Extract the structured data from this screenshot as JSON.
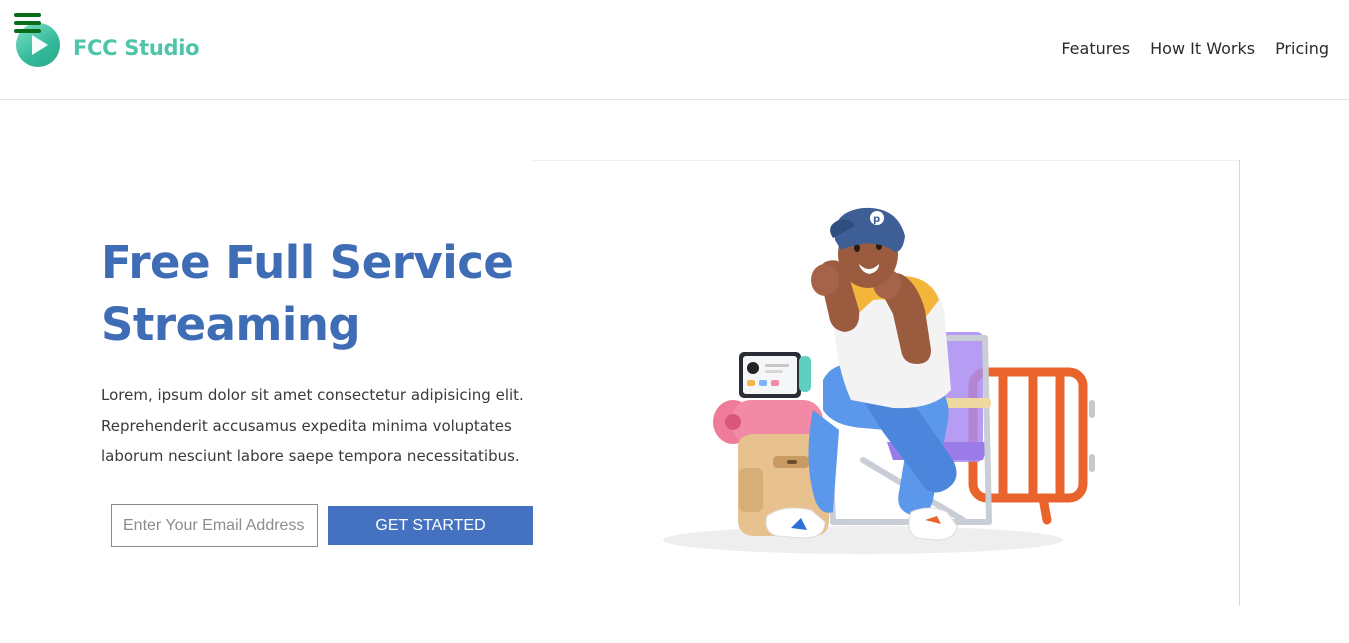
{
  "header": {
    "brand": "FCC Studio",
    "menu_icon": "hamburger-menu-icon",
    "logo_icon": "play-logo-icon",
    "nav": [
      {
        "label": "Features"
      },
      {
        "label": "How It Works"
      },
      {
        "label": "Pricing"
      }
    ]
  },
  "hero": {
    "title": "Free Full Service Streaming",
    "description": "Lorem, ipsum dolor sit amet consectetur adipisicing elit. Reprehenderit accusamus expedita minima voluptates laborum nesciunt labore saepe tempora necessitatibus.",
    "email_placeholder": "Enter Your Email Address",
    "email_value": "",
    "cta_label": "GET STARTED"
  },
  "illustration": {
    "name": "character-on-chair-illustration"
  },
  "colors": {
    "brand": "#4ec4a8",
    "title": "#3f6db5",
    "button": "#4472c0",
    "menu": "#0a6b1b"
  }
}
